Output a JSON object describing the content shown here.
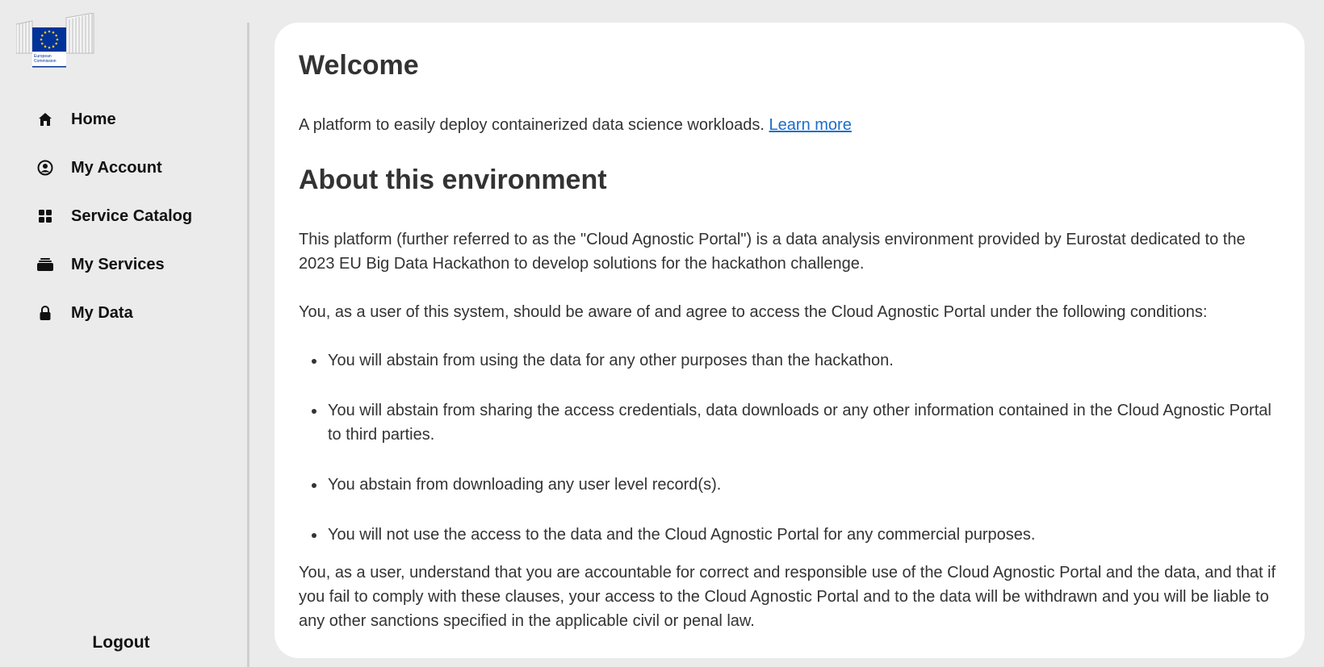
{
  "logo": {
    "text_line1": "European",
    "text_line2": "Commission",
    "colors": {
      "flag_blue": "#003399",
      "star_yellow": "#ffcc00"
    }
  },
  "sidebar": {
    "items": [
      {
        "label": "Home",
        "icon": "home-icon"
      },
      {
        "label": "My Account",
        "icon": "account-circle-icon"
      },
      {
        "label": "Service Catalog",
        "icon": "grid-icon"
      },
      {
        "label": "My Services",
        "icon": "briefcase-icon"
      },
      {
        "label": "My Data",
        "icon": "lock-icon"
      }
    ],
    "logout_label": "Logout"
  },
  "main": {
    "welcome_title": "Welcome",
    "intro_text": "A platform to easily deploy containerized data science workloads.",
    "learn_more": "Learn more",
    "about_title": "About this environment",
    "para1": "This platform (further referred to as the \"Cloud Agnostic Portal\") is a data analysis environment provided by Eurostat dedicated to the 2023 EU Big Data Hackathon to develop solutions for the hackathon challenge.",
    "para2": "You, as a user of this system, should be aware of and agree to access the Cloud Agnostic Portal under the following conditions:",
    "conditions": [
      "You will abstain from using the data for any other purposes than the hackathon.",
      "You will abstain from sharing the access credentials, data downloads or any other information contained in the Cloud Agnostic Portal to third parties.",
      "You abstain from downloading any user level record(s).",
      "You will not use the access to the data and the Cloud Agnostic Portal for any commercial purposes."
    ],
    "para3": "You, as a user, understand that you are accountable for correct and responsible use of the Cloud Agnostic Portal and the data, and that if you fail to comply with these clauses, your access to the Cloud Agnostic Portal and to the data will be withdrawn and you will be liable to any other sanctions specified in the applicable civil or penal law."
  },
  "colors": {
    "link": "#1a6dcc",
    "background": "#ebebeb",
    "card": "#ffffff"
  }
}
